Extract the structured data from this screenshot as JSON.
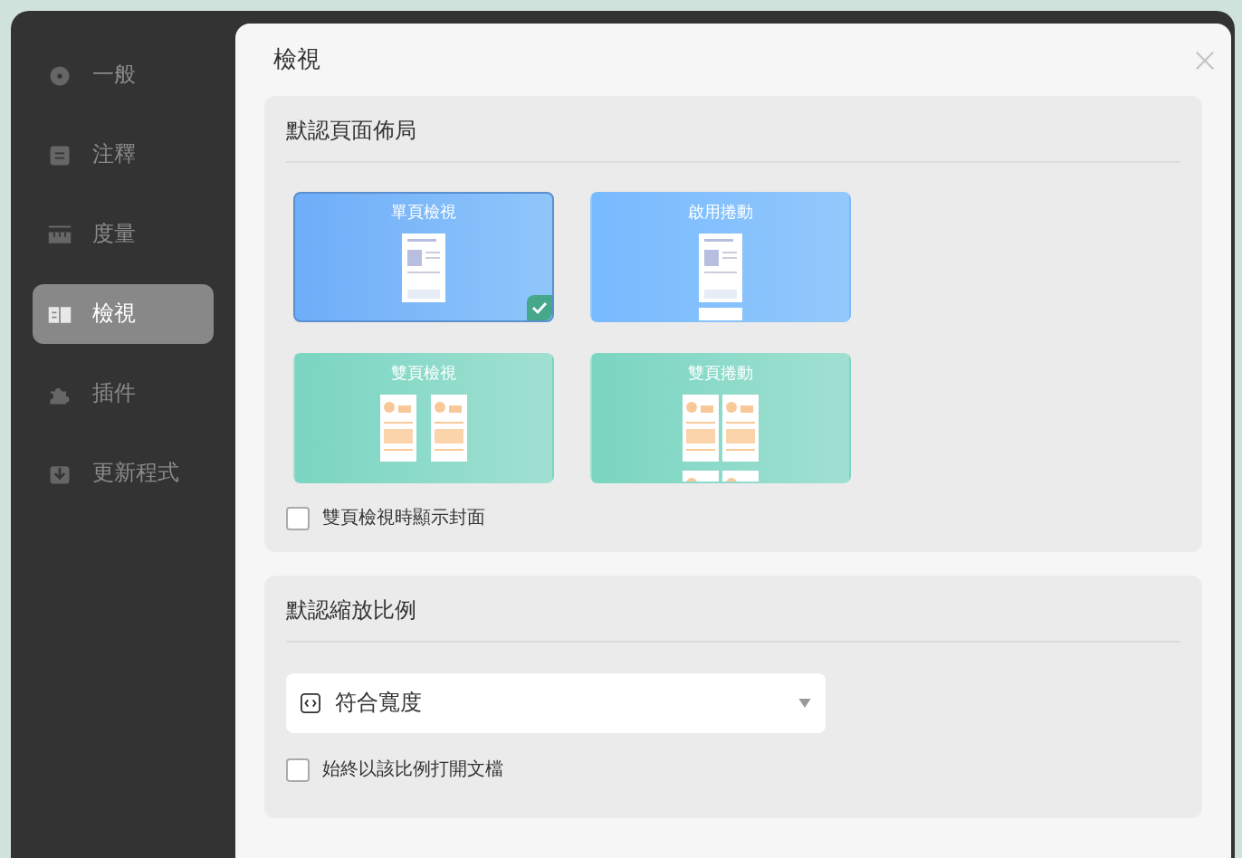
{
  "sidebar": {
    "items": [
      {
        "label": "一般",
        "selected": false
      },
      {
        "label": "注釋",
        "selected": false
      },
      {
        "label": "度量",
        "selected": false
      },
      {
        "label": "檢視",
        "selected": true
      },
      {
        "label": "插件",
        "selected": false
      },
      {
        "label": "更新程式",
        "selected": false
      }
    ]
  },
  "dialog": {
    "title": "檢視",
    "layout_section": {
      "heading": "默認頁面佈局",
      "options": [
        {
          "label": "單頁檢視",
          "kind": "single",
          "selected": true
        },
        {
          "label": "啟用捲動",
          "kind": "single-scroll",
          "selected": false
        },
        {
          "label": "雙頁檢視",
          "kind": "double",
          "selected": false
        },
        {
          "label": "雙頁捲動",
          "kind": "double-scroll",
          "selected": false
        }
      ],
      "cover_checkbox": {
        "label": "雙頁檢視時顯示封面",
        "checked": false
      }
    },
    "zoom_section": {
      "heading": "默認縮放比例",
      "select": {
        "value": "符合寬度"
      },
      "always_checkbox": {
        "label": "始終以該比例打開文檔",
        "checked": false
      }
    }
  }
}
